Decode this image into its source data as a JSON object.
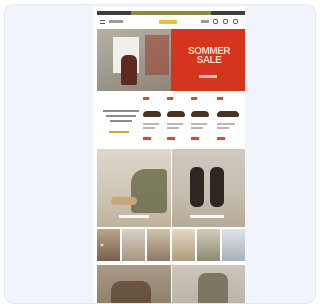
{
  "hero": {
    "sale_line1": "SOMMER",
    "sale_line2": "SALE"
  },
  "icons": {
    "menu": "menu-icon",
    "search": "search-icon",
    "account": "user-icon",
    "cart": "bag-icon"
  },
  "colors": {
    "accent_red": "#d5341e",
    "logo_yellow": "#e2c239",
    "top_bar": "#3b3e3a"
  }
}
